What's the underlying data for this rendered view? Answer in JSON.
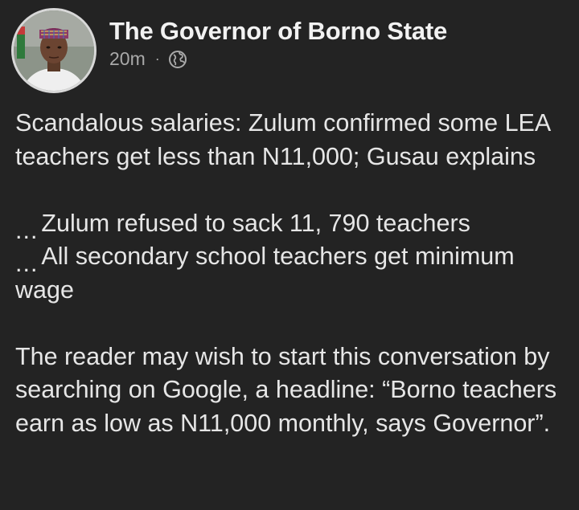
{
  "post": {
    "author": "The Governor of Borno State",
    "time": "20m",
    "separator": "·",
    "audience_icon": "globe-icon",
    "paragraphs": {
      "p1": "Scandalous salaries: Zulum confirmed some LEA teachers get less than N11,000; Gusau explains",
      "bullet1_marker": "...",
      "bullet1_text": "Zulum refused to sack 11, 790 teachers",
      "bullet2_marker": "...",
      "bullet2_text": "All secondary school teachers get minimum wage",
      "p3": "The reader may wish to start this conversation by searching on Google, a headline: “Borno teachers earn as low as N11,000 monthly, says Governor”."
    }
  },
  "colors": {
    "background": "#232323",
    "text": "#e6e6e6",
    "muted": "#a9a9a9"
  }
}
